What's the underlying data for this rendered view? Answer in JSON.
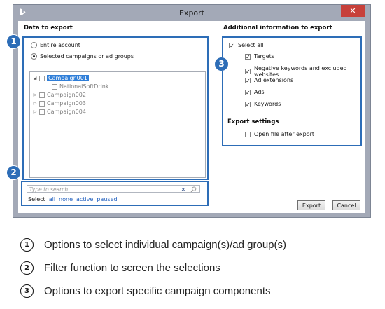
{
  "window": {
    "title": "Export",
    "close_glyph": "✕",
    "app_icon": "bing-logo-icon"
  },
  "data_to_export": {
    "heading": "Data to export",
    "radio_entire": "Entire account",
    "radio_selected": "Selected campaigns or ad groups",
    "selected_option": "Selected campaigns or ad groups",
    "tree": [
      {
        "label": "Campaign001",
        "expanded": true,
        "selected": true
      },
      {
        "label": "NationalSoftDrink",
        "child": true
      },
      {
        "label": "Campaign002"
      },
      {
        "label": "Campaign003"
      },
      {
        "label": "Campaign004"
      }
    ]
  },
  "filter": {
    "placeholder": "Type to search",
    "clear_glyph": "✕",
    "select_label": "Select",
    "links": [
      "all",
      "none",
      "active",
      "paused"
    ]
  },
  "additional": {
    "heading": "Additional information to export",
    "options": [
      {
        "label": "Select all",
        "checked": true
      },
      {
        "label": "Targets",
        "checked": true
      },
      {
        "label": "Negative keywords and excluded websites",
        "checked": true
      },
      {
        "label": "Ad extensions",
        "checked": true
      },
      {
        "label": "Ads",
        "checked": true
      },
      {
        "label": "Keywords",
        "checked": true
      }
    ]
  },
  "export_settings": {
    "heading": "Export settings",
    "option": {
      "label": "Open file after export",
      "checked": false
    }
  },
  "buttons": {
    "export": "Export",
    "cancel": "Cancel"
  },
  "callouts": [
    "1",
    "2",
    "3"
  ],
  "legend": [
    {
      "num": "1",
      "text": "Options to select individual campaign(s)/ad group(s)"
    },
    {
      "num": "2",
      "text": "Filter function to screen the selections"
    },
    {
      "num": "3",
      "text": "Options to export specific campaign components"
    }
  ],
  "colors": {
    "accent": "#2d6db7",
    "close": "#c7403a",
    "frame": "#a3a9b7",
    "selection": "#2f7ed8"
  }
}
